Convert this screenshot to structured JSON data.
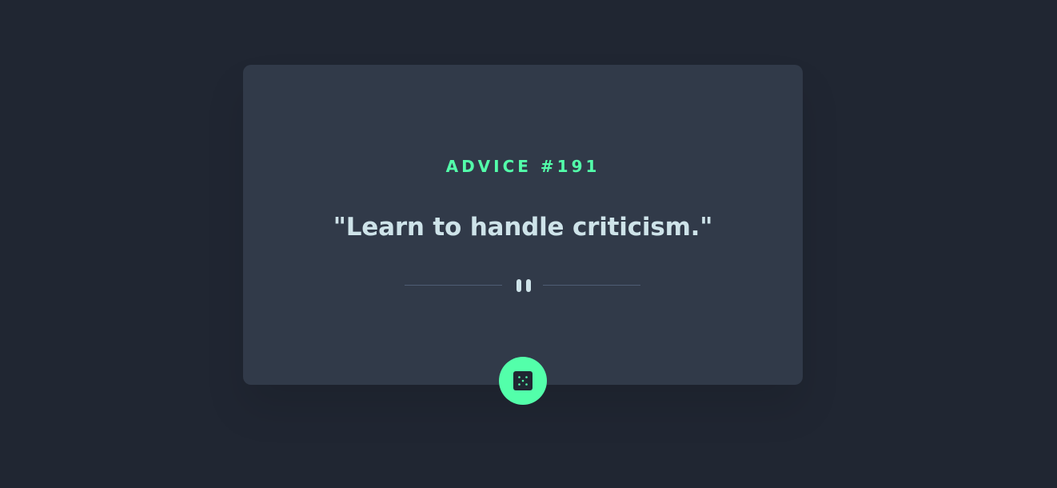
{
  "advice": {
    "id_label": "ADVICE #191",
    "text": "\"Learn to handle criticism.\""
  },
  "icons": {
    "divider": "pause-icon",
    "button": "dice-icon"
  },
  "colors": {
    "background": "#202632",
    "card": "#313a49",
    "accent": "#53ffaa",
    "text": "#cee3e9",
    "divider_line": "#4f5d74"
  }
}
